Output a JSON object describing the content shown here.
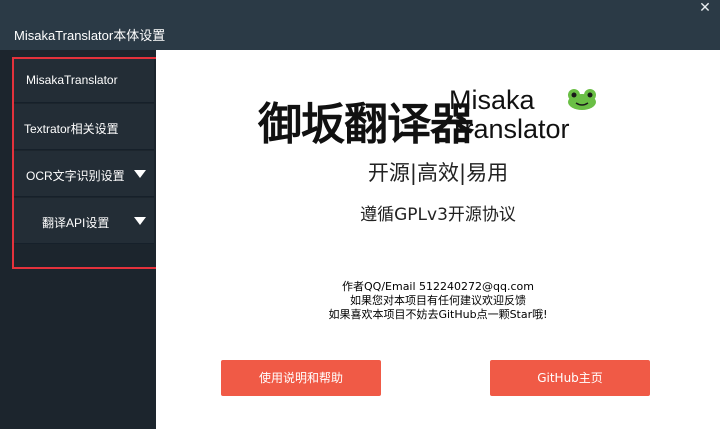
{
  "window": {
    "title": "MisakaTranslator本体设置",
    "close_glyph": "✕"
  },
  "sidebar": {
    "items": [
      {
        "label": "MisakaTranslator",
        "has_arrow": false
      },
      {
        "label": "Textrator相关设置",
        "has_arrow": false
      },
      {
        "label": "OCR文字识别设置",
        "has_arrow": true
      },
      {
        "label": "翻译API设置",
        "has_arrow": true
      }
    ]
  },
  "main": {
    "logo_cn": "御坂翻译器",
    "logo_en_line1": "Misaka",
    "logo_en_line2": "Translator",
    "logo_icon": "frog-icon",
    "slogan": "开源|高效|易用",
    "license": "遵循GPLv3开源协议",
    "info_lines": [
      "作者QQ/Email 512240272@qq.com",
      "如果您对本项目有任何建议欢迎反馈",
      "如果喜欢本项目不妨去GitHub点一颗Star哦!"
    ],
    "buttons": {
      "help_label": "使用说明和帮助",
      "github_label": "GitHub主页"
    }
  },
  "colors": {
    "titlebar_bg": "#2b3a46",
    "sidebar_bg": "#1c252d",
    "nav_item_bg": "#232d36",
    "accent_button": "#f05a46",
    "annotation_box": "#e4323c",
    "frog_green": "#6abf45"
  }
}
